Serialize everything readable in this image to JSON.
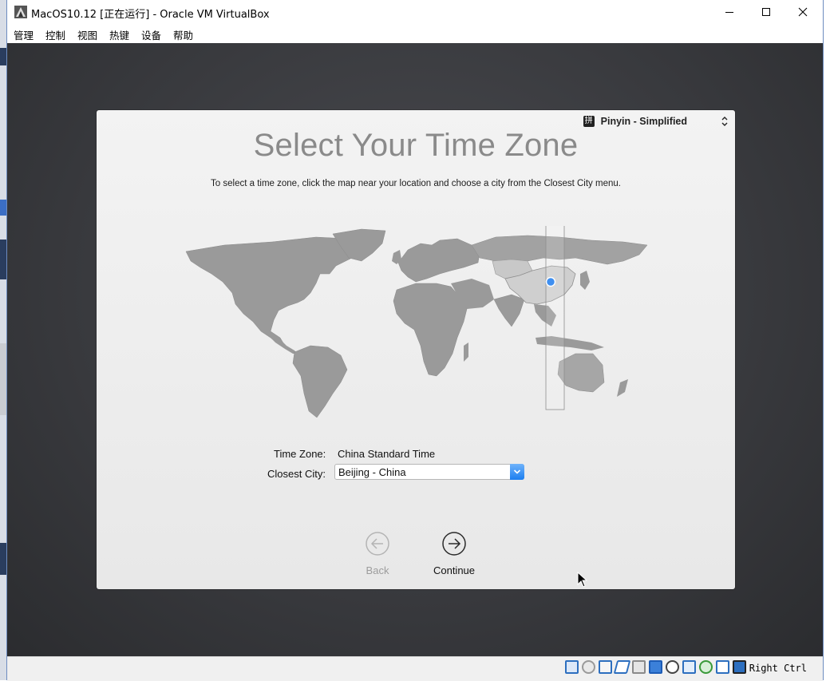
{
  "window": {
    "title": "MacOS10.12 [正在运行] - Oracle VM VirtualBox"
  },
  "menu": [
    "管理",
    "控制",
    "视图",
    "热键",
    "设备",
    "帮助"
  ],
  "installer": {
    "input_method": {
      "icon": "拼",
      "label": "Pinyin - Simplified"
    },
    "heading": "Select Your Time Zone",
    "instructions": "To select a time zone, click the map near your location and choose a city from the Closest City menu.",
    "time_zone_label": "Time Zone:",
    "time_zone_value": "China Standard Time",
    "closest_city_label": "Closest City:",
    "closest_city_value": "Beijing - China",
    "back_label": "Back",
    "continue_label": "Continue",
    "back_enabled": false
  },
  "status_bar": {
    "icons": [
      "hard-disk-icon",
      "optical-drive-icon",
      "network-icon",
      "usb-icon",
      "shared-folder-icon",
      "display-icon",
      "video-capture-icon",
      "guest-additions-icon",
      "cpu-icon",
      "mouse-integration-icon",
      "keyboard-capture-icon"
    ],
    "host_key": "Right Ctrl"
  },
  "colors": {
    "accent": "#1c7ef0",
    "vm_background": "#3a3b3f",
    "map_land": "#9a9a9a",
    "map_highlight": "#c8c8c8"
  }
}
